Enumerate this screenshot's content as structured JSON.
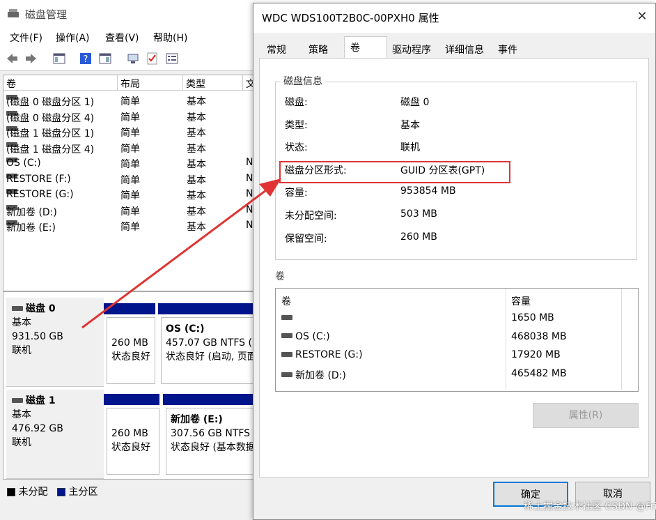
{
  "background_window": {
    "title": "磁盘管理",
    "menu": [
      "文件(F)",
      "操作(A)",
      "查看(V)",
      "帮助(H)"
    ],
    "toolbar_icons": [
      "back-icon",
      "forward-icon",
      "console-tree-icon",
      "help-icon",
      "properties-icon",
      "connect-icon",
      "check-icon",
      "settings-icon"
    ],
    "columns": [
      "卷",
      "布局",
      "类型",
      "文"
    ],
    "volumes": [
      {
        "name": "(磁盘 0 磁盘分区 1)",
        "layout": "简单",
        "type": "基本",
        "fs": ""
      },
      {
        "name": "(磁盘 0 磁盘分区 4)",
        "layout": "简单",
        "type": "基本",
        "fs": ""
      },
      {
        "name": "(磁盘 1 磁盘分区 1)",
        "layout": "简单",
        "type": "基本",
        "fs": ""
      },
      {
        "name": "(磁盘 1 磁盘分区 4)",
        "layout": "简单",
        "type": "基本",
        "fs": ""
      },
      {
        "name": "OS (C:)",
        "layout": "简单",
        "type": "基本",
        "fs": "N"
      },
      {
        "name": "RESTORE (F:)",
        "layout": "简单",
        "type": "基本",
        "fs": "N"
      },
      {
        "name": "RESTORE (G:)",
        "layout": "简单",
        "type": "基本",
        "fs": "N"
      },
      {
        "name": "新加卷 (D:)",
        "layout": "简单",
        "type": "基本",
        "fs": "N"
      },
      {
        "name": "新加卷 (E:)",
        "layout": "简单",
        "type": "基本",
        "fs": "N"
      }
    ],
    "disks": [
      {
        "name": "磁盘 0",
        "type": "基本",
        "size": "931.50 GB",
        "status": "联机",
        "p1_size": "260 MB",
        "p1_status": "状态良好",
        "p2_name": "OS  (C:)",
        "p2_size": "457.07 GB NTFS (B",
        "p2_status": "状态良好 (启动, 页面"
      },
      {
        "name": "磁盘 1",
        "type": "基本",
        "size": "476.92 GB",
        "status": "联机",
        "p1_size": "260 MB",
        "p1_status": "状态良好",
        "p2_name": "新加卷  (E:)",
        "p2_size": "307.56 GB NTFS (",
        "p2_status": "状态良好 (基本数据"
      }
    ],
    "legend": [
      {
        "label": "未分配",
        "color": "#000000"
      },
      {
        "label": "主分区",
        "color": "#00158c"
      }
    ]
  },
  "dialog": {
    "title": "WDC WDS100T2B0C-00PXH0 属性",
    "close": "✕",
    "tabs": [
      "常规",
      "策略",
      "卷",
      "驱动程序",
      "详细信息",
      "事件"
    ],
    "selected_tab": "卷",
    "disk_info_title": "磁盘信息",
    "disk_info": [
      {
        "key": "磁盘:",
        "value": "磁盘 0"
      },
      {
        "key": "类型:",
        "value": "基本"
      },
      {
        "key": "状态:",
        "value": "联机"
      },
      {
        "key": "磁盘分区形式:",
        "value": "GUID 分区表(GPT)"
      },
      {
        "key": "容量:",
        "value": "953854 MB"
      },
      {
        "key": "未分配空间:",
        "value": "503 MB"
      },
      {
        "key": "保留空间:",
        "value": "260 MB"
      }
    ],
    "volumes_title": "卷",
    "volume_columns": [
      "卷",
      "容量"
    ],
    "volume_rows": [
      {
        "name": "",
        "capacity": "1650 MB"
      },
      {
        "name": "OS (C:)",
        "capacity": "468038 MB"
      },
      {
        "name": "RESTORE (G:)",
        "capacity": "17920 MB"
      },
      {
        "name": "新加卷 (D:)",
        "capacity": "465482 MB"
      }
    ],
    "properties_button": "属性(R)",
    "ok_button": "确定",
    "cancel_button": "取消"
  },
  "annotation_color": "#e03434",
  "watermark": "CSDN @FrigidWinter",
  "watermark_cn": "稀土掘金技术社区"
}
